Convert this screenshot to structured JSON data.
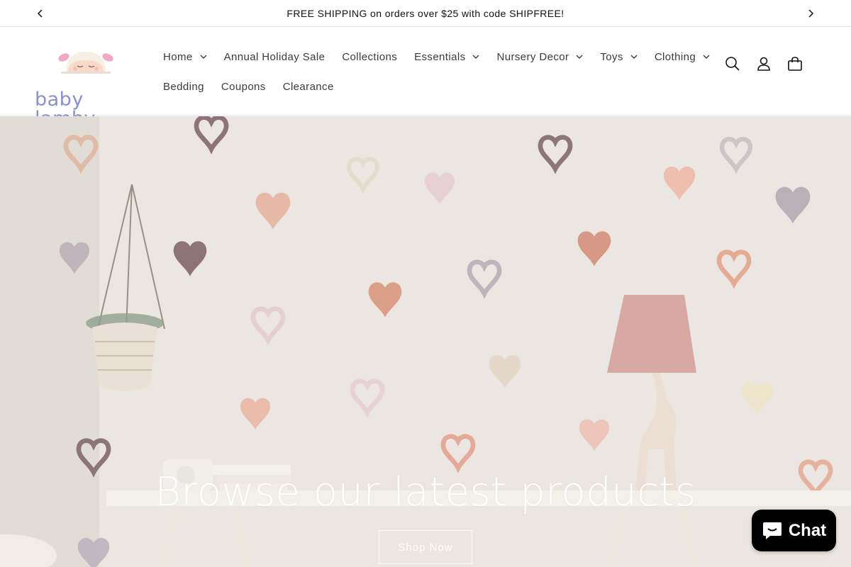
{
  "announcement": {
    "text": "FREE SHIPPING on orders over $25 with code SHIPFREE!",
    "prev_icon": "chevron-left-icon",
    "next_icon": "chevron-right-icon"
  },
  "brand": {
    "logo_text": "baby lamby",
    "logo_color": "#8a8fd2"
  },
  "nav": {
    "row1": [
      {
        "label": "Home",
        "dropdown": true
      },
      {
        "label": "Annual Holiday Sale",
        "dropdown": false
      },
      {
        "label": "Collections",
        "dropdown": false
      },
      {
        "label": "Essentials",
        "dropdown": true
      },
      {
        "label": "Nursery Decor",
        "dropdown": true
      },
      {
        "label": "Toys",
        "dropdown": true
      },
      {
        "label": "Clothing",
        "dropdown": true
      }
    ],
    "row2": [
      {
        "label": "Bedding",
        "dropdown": false
      },
      {
        "label": "Coupons",
        "dropdown": false
      },
      {
        "label": "Clearance",
        "dropdown": false
      }
    ]
  },
  "header_icons": [
    "search-icon",
    "account-icon",
    "cart-icon"
  ],
  "hero": {
    "title": "Browse our latest products",
    "button_label": "Shop Now"
  },
  "chat": {
    "label": "Chat",
    "icon": "chat-bubble-icon"
  }
}
